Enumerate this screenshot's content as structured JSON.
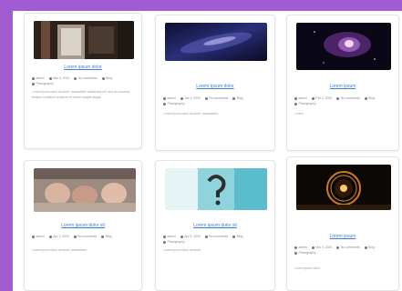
{
  "colors": {
    "frame": "#a35bd3",
    "link": "#3f7fd6"
  },
  "cards": [
    {
      "title": "Lorem ipsum dolor",
      "meta": [
        "admin",
        "Mar 8, 2024",
        "No comments",
        "Blog",
        "Photography"
      ],
      "excerpt": "Lorem ipsum dolor sit amet, consectetur adipiscing elit, sed do eiusmod tempor incididunt ut labore et dolore magna aliqua."
    },
    {
      "title": "Lorem ipsum dolor",
      "meta": [
        "admin",
        "Jan 4, 2024",
        "No comments",
        "Blog",
        "Photography"
      ],
      "excerpt": "Lorem ipsum dolor sit amet, consectetur."
    },
    {
      "title": "Lorem ipsum",
      "meta": [
        "admin",
        "Feb 2, 2024",
        "No comments",
        "Blog",
        "Photography"
      ],
      "excerpt": "Lorem."
    },
    {
      "title": "Lorem ipsum dolor sit",
      "meta": [
        "admin",
        "Apr 1, 2024",
        "No comments",
        "Blog"
      ],
      "excerpt": "Lorem ipsum dolor sit amet, consectetur."
    },
    {
      "title": "Lorem ipsum dolor sit",
      "meta": [
        "admin",
        "Apr 5, 2024",
        "No comments",
        "Blog",
        "Photography"
      ],
      "excerpt": "Lorem ipsum dolor sit amet."
    },
    {
      "title": "Lorem ipsum",
      "meta": [
        "admin",
        "Mar 3, 2024",
        "No comments",
        "Blog",
        "Photography"
      ],
      "excerpt": "Lorem ipsum dolor."
    }
  ]
}
